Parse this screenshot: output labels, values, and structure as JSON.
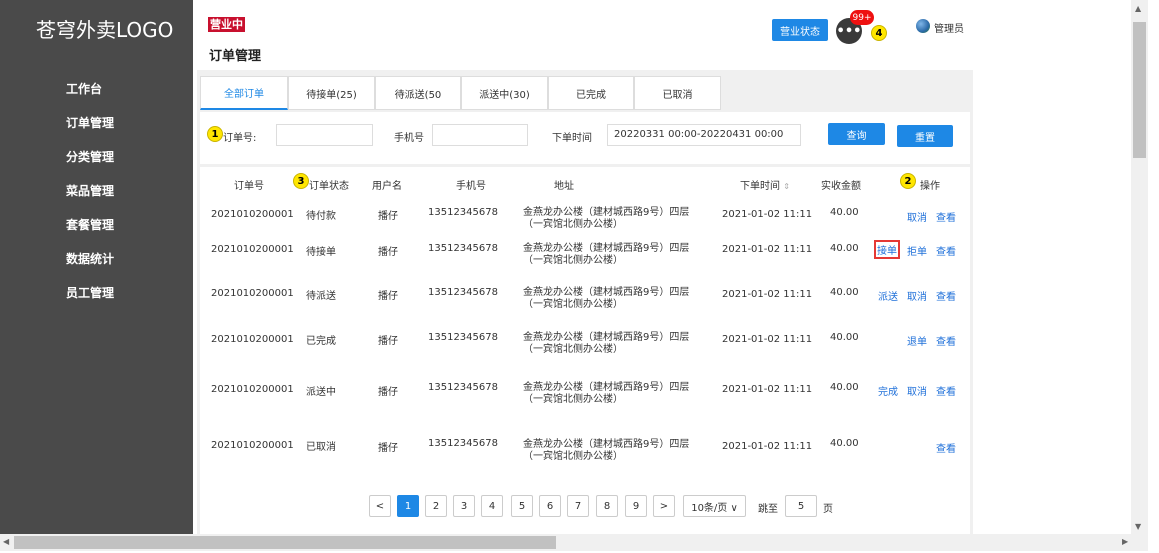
{
  "app": {
    "logo": "苍穹外卖LOGO",
    "status_badge": "营业中",
    "page_title": "订单管理",
    "business_status_button": "营业状态",
    "message_icon": "•••",
    "message_badge": "99+",
    "admin_name": "管理员"
  },
  "sidebar": {
    "items": [
      {
        "label": "工作台"
      },
      {
        "label": "订单管理"
      },
      {
        "label": "分类管理"
      },
      {
        "label": "菜品管理"
      },
      {
        "label": "套餐管理"
      },
      {
        "label": "数据统计"
      },
      {
        "label": "员工管理"
      }
    ]
  },
  "tabs": [
    {
      "label": "全部订单",
      "active": true
    },
    {
      "label": "待接单(25)"
    },
    {
      "label": "待派送(50"
    },
    {
      "label": "派送中(30)"
    },
    {
      "label": "已完成"
    },
    {
      "label": "已取消"
    }
  ],
  "filters": {
    "order_no_label": "订单号:",
    "phone_label": "手机号",
    "time_label": "下单时间",
    "time_value": "20220331 00:00-20220431 00:00",
    "search_button": "查询",
    "reset_button": "重置"
  },
  "markers": [
    "1",
    "2",
    "3",
    "4"
  ],
  "table": {
    "headers": [
      "订单号",
      "订单状态",
      "用户名",
      "手机号",
      "地址",
      "下单时间",
      "实收金额",
      "操作"
    ],
    "sort_icon": "⇕",
    "rows": [
      {
        "order_no": "2021010200001",
        "status": "待付款",
        "user": "播仔",
        "phone": "13512345678",
        "addr1": "金燕龙办公楼（建材城西路9号）四层",
        "addr2": "（一宾馆北侧办公楼）",
        "time": "2021-01-02 11:11",
        "amount": "40.00",
        "ops": [
          "取消",
          "查看"
        ]
      },
      {
        "order_no": "2021010200001",
        "status": "待接单",
        "user": "播仔",
        "phone": "13512345678",
        "addr1": "金燕龙办公楼（建材城西路9号）四层",
        "addr2": "（一宾馆北侧办公楼）",
        "time": "2021-01-02 11:11",
        "amount": "40.00",
        "ops": [
          "接单",
          "拒单",
          "查看"
        ]
      },
      {
        "order_no": "2021010200001",
        "status": "待派送",
        "user": "播仔",
        "phone": "13512345678",
        "addr1": "金燕龙办公楼（建材城西路9号）四层",
        "addr2": "（一宾馆北侧办公楼）",
        "time": "2021-01-02 11:11",
        "amount": "40.00",
        "ops": [
          "派送",
          "取消",
          "查看"
        ]
      },
      {
        "order_no": "2021010200001",
        "status": "已完成",
        "user": "播仔",
        "phone": "13512345678",
        "addr1": "金燕龙办公楼（建材城西路9号）四层",
        "addr2": "（一宾馆北侧办公楼）",
        "time": "2021-01-02 11:11",
        "amount": "40.00",
        "ops": [
          "退单",
          "查看"
        ]
      },
      {
        "order_no": "2021010200001",
        "status": "派送中",
        "user": "播仔",
        "phone": "13512345678",
        "addr1": "金燕龙办公楼（建材城西路9号）四层",
        "addr2": "（一宾馆北侧办公楼）",
        "time": "2021-01-02 11:11",
        "amount": "40.00",
        "ops": [
          "完成",
          "取消",
          "查看"
        ]
      },
      {
        "order_no": "2021010200001",
        "status": "已取消",
        "user": "播仔",
        "phone": "13512345678",
        "addr1": "金燕龙办公楼（建材城西路9号）四层",
        "addr2": "（一宾馆北侧办公楼）",
        "time": "2021-01-02 11:11",
        "amount": "40.00",
        "ops": [
          "查看"
        ]
      }
    ]
  },
  "pagination": {
    "prev": "<",
    "pages": [
      "1",
      "2",
      "3",
      "4",
      "5",
      "6",
      "7",
      "8",
      "9"
    ],
    "current": "1",
    "next": ">",
    "page_size": "10条/页 ∨",
    "jump_label": "跳至",
    "jump_value": "5",
    "page_unit": "页"
  },
  "colors": {
    "sidebar_bg": "#4a4a4a",
    "accent": "#1e88e5",
    "status_badge": "#c8102e",
    "marker": "#ffe600",
    "highlight_border": "#e53935"
  }
}
